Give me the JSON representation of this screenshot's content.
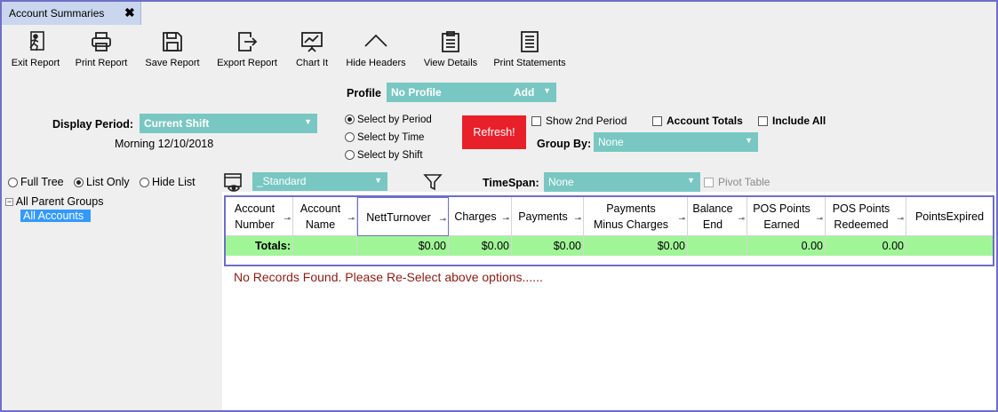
{
  "tab": {
    "title": "Account Summaries",
    "close": "✖"
  },
  "toolbar": {
    "exit": "Exit Report",
    "print": "Print Report",
    "save": "Save Report",
    "export": "Export Report",
    "chart": "Chart It",
    "hide_headers": "Hide Headers",
    "view_details": "View Details",
    "print_statements": "Print Statements"
  },
  "profile": {
    "label": "Profile",
    "value": "No Profile",
    "add": "Add"
  },
  "display_period": {
    "label": "Display Period:",
    "value": "Current Shift",
    "subtitle": "Morning 12/10/2018"
  },
  "select_options": [
    "Select by Period",
    "Select  by Time",
    "Select by Shift"
  ],
  "refresh": "Refresh!",
  "checks": {
    "show_2nd": "Show 2nd Period",
    "account_totals": "Account Totals",
    "include_all": "Include All",
    "pivot": "Pivot Table"
  },
  "group_by": {
    "label": "Group By:",
    "value": "None"
  },
  "tree_options": [
    "Full Tree",
    "List Only",
    "Hide List"
  ],
  "layout_select": "_Standard",
  "timespan": {
    "label": "TimeSpan:",
    "value": "None"
  },
  "tree": {
    "root": "All Parent Groups",
    "child": "All Accounts"
  },
  "grid": {
    "headers": [
      [
        "Account",
        "Number"
      ],
      [
        "Account",
        "Name"
      ],
      [
        "NettTurnover"
      ],
      [
        "Charges"
      ],
      [
        "Payments"
      ],
      [
        "Payments",
        "Minus Charges"
      ],
      [
        "Balance",
        "End"
      ],
      [
        "POS Points",
        "Earned"
      ],
      [
        "POS Points",
        "Redeemed"
      ],
      [
        "PointsExpired"
      ]
    ],
    "totals_label": "Totals:",
    "totals": [
      "",
      "",
      "$0.00",
      "$0.00",
      "$0.00",
      "$0.00",
      "",
      "0.00",
      "0.00",
      ""
    ]
  },
  "no_records": "No Records Found. Please Re-Select above options......",
  "colors": {
    "dropdown": "#79c7c2",
    "totals_row": "#a0f597",
    "refresh": "#e8202a",
    "frame": "#6d6fc9",
    "selected": "#3399ff"
  }
}
